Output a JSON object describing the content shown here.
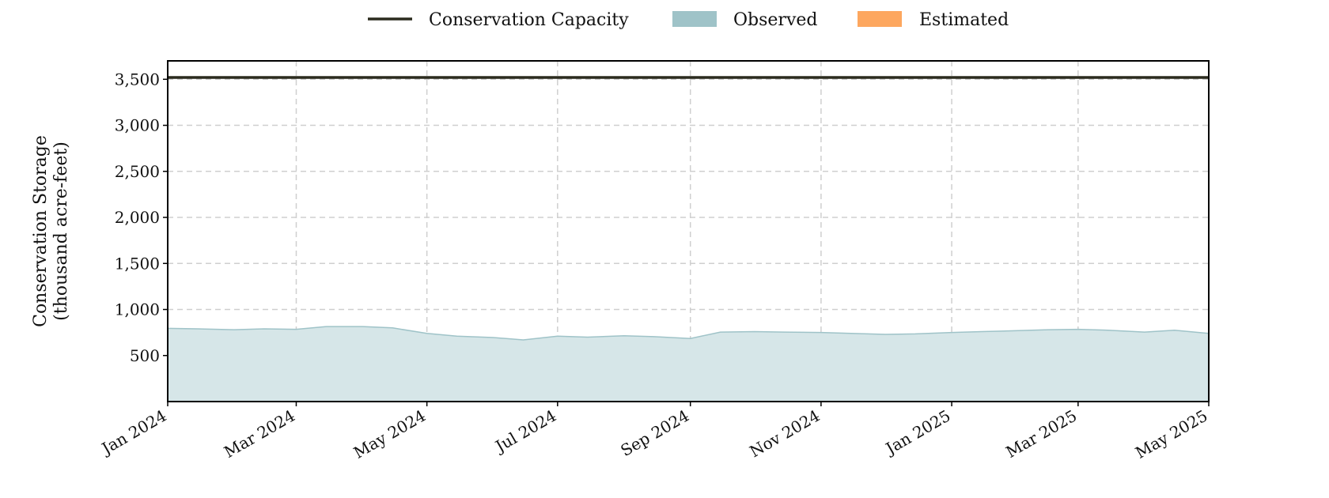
{
  "chart_data": {
    "type": "area",
    "ylabel": [
      "Conservation Storage",
      "(thousand acre-feet)"
    ],
    "ylim": [
      0,
      3700
    ],
    "xlim": [
      "2024-01-01",
      "2025-05-01"
    ],
    "y_ticks": [
      500,
      1000,
      1500,
      2000,
      2500,
      3000,
      3500
    ],
    "y_tick_labels": [
      "500",
      "1,000",
      "1,500",
      "2,000",
      "2,500",
      "3,000",
      "3,500"
    ],
    "x_ticks": [
      "2024-01-01",
      "2024-03-01",
      "2024-05-01",
      "2024-07-01",
      "2024-09-01",
      "2024-11-01",
      "2025-01-01",
      "2025-03-01",
      "2025-05-01"
    ],
    "x_tick_labels": [
      "Jan 2024",
      "Mar 2024",
      "May 2024",
      "Jul 2024",
      "Sep 2024",
      "Nov 2024",
      "Jan 2025",
      "Mar 2025",
      "May 2025"
    ],
    "grid": true,
    "legend_position": "top-center",
    "legend": [
      {
        "label": "Conservation Capacity",
        "kind": "line",
        "color": "#2b2b1e"
      },
      {
        "label": "Observed",
        "kind": "patch",
        "color": "#9fc3c8"
      },
      {
        "label": "Estimated",
        "kind": "patch",
        "color": "#fda75f"
      }
    ],
    "series": [
      {
        "name": "Conservation Capacity",
        "kind": "line",
        "color": "#2b2b1e",
        "x": [
          "2024-01-01",
          "2025-05-01"
        ],
        "values": [
          3520,
          3520
        ]
      },
      {
        "name": "Observed",
        "kind": "area",
        "color": "#9fc3c8",
        "fill": "#d6e6e8",
        "x": [
          "2024-01-01",
          "2024-01-15",
          "2024-02-01",
          "2024-02-15",
          "2024-03-01",
          "2024-03-15",
          "2024-04-01",
          "2024-04-15",
          "2024-05-01",
          "2024-05-15",
          "2024-06-01",
          "2024-06-15",
          "2024-07-01",
          "2024-07-15",
          "2024-08-01",
          "2024-08-15",
          "2024-09-01",
          "2024-09-15",
          "2024-10-01",
          "2024-10-15",
          "2024-11-01",
          "2024-11-15",
          "2024-12-01",
          "2024-12-15",
          "2025-01-01",
          "2025-01-15",
          "2025-02-01",
          "2025-02-15",
          "2025-03-01",
          "2025-03-15",
          "2025-04-01",
          "2025-04-15",
          "2025-05-01"
        ],
        "values": [
          795,
          790,
          780,
          790,
          785,
          815,
          815,
          800,
          740,
          710,
          695,
          670,
          710,
          700,
          715,
          705,
          685,
          755,
          760,
          755,
          750,
          740,
          730,
          735,
          750,
          760,
          770,
          780,
          785,
          775,
          755,
          775,
          740
        ]
      }
    ]
  }
}
